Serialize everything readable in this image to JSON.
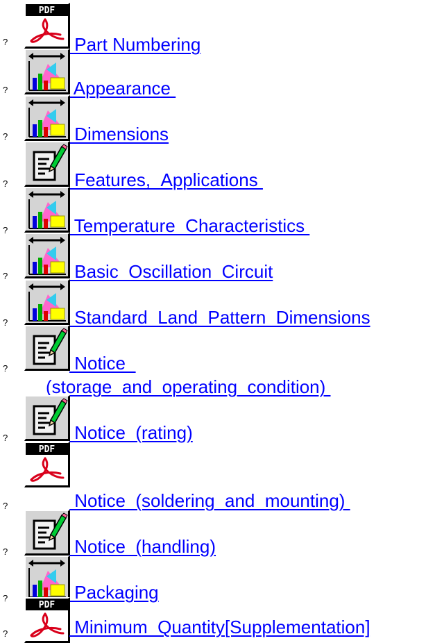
{
  "bullet_char": "?",
  "items": [
    {
      "label": " Part Numbering",
      "icon": "pdf-icon"
    },
    {
      "label": " Appearance ",
      "icon": "chart-icon"
    },
    {
      "label": " Dimensions",
      "icon": "chart-icon"
    },
    {
      "label": " Features,_Applications ",
      "icon": "document-icon"
    },
    {
      "label": " Temperature_Characteristics ",
      "icon": "chart-icon"
    },
    {
      "label": " Basic_Oscillation_Circuit",
      "icon": "chart-icon"
    },
    {
      "label": " Standard_Land_Pattern_Dimensions",
      "icon": "chart-icon"
    },
    {
      "label": " Notice_",
      "label_line2": "(storage_and_operating_condition) ",
      "icon": "document-icon"
    },
    {
      "label": " Notice_(rating)",
      "icon": "document-icon"
    },
    {
      "label": " Notice_(soldering_and_mounting) ",
      "icon": "pdf-icon"
    },
    {
      "label": " Notice_(handling)",
      "icon": "document-icon"
    },
    {
      "label": " Packaging",
      "icon": "chart-icon"
    },
    {
      "label": " Minimum_Quantity[Supplementation]",
      "icon": "pdf-icon"
    }
  ],
  "icon_text": {
    "pdf": "PDF"
  },
  "colors": {
    "link": "#0000ff",
    "pdf_red": "#d9001b"
  }
}
